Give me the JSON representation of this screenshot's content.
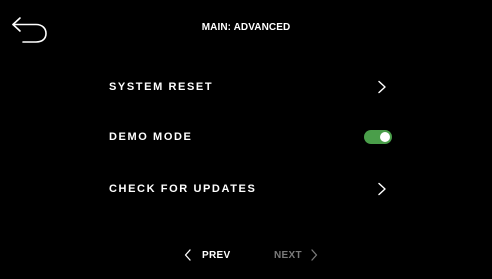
{
  "header": {
    "title": "MAIN: ADVANCED",
    "back_icon": "back-arrow-icon"
  },
  "menu": {
    "items": [
      {
        "label": "SYSTEM RESET",
        "control": "chevron-right-icon"
      },
      {
        "label": "DEMO MODE",
        "control": "toggle",
        "toggle_state": "on"
      },
      {
        "label": "CHECK FOR UPDATES",
        "control": "chevron-right-icon"
      }
    ]
  },
  "pager": {
    "prev_label": "PREV",
    "next_label": "NEXT",
    "next_enabled": false
  },
  "colors": {
    "background": "#000000",
    "text": "#ffffff",
    "toggle_on": "#4a9e4a",
    "disabled_text": "#7a7a7a"
  }
}
